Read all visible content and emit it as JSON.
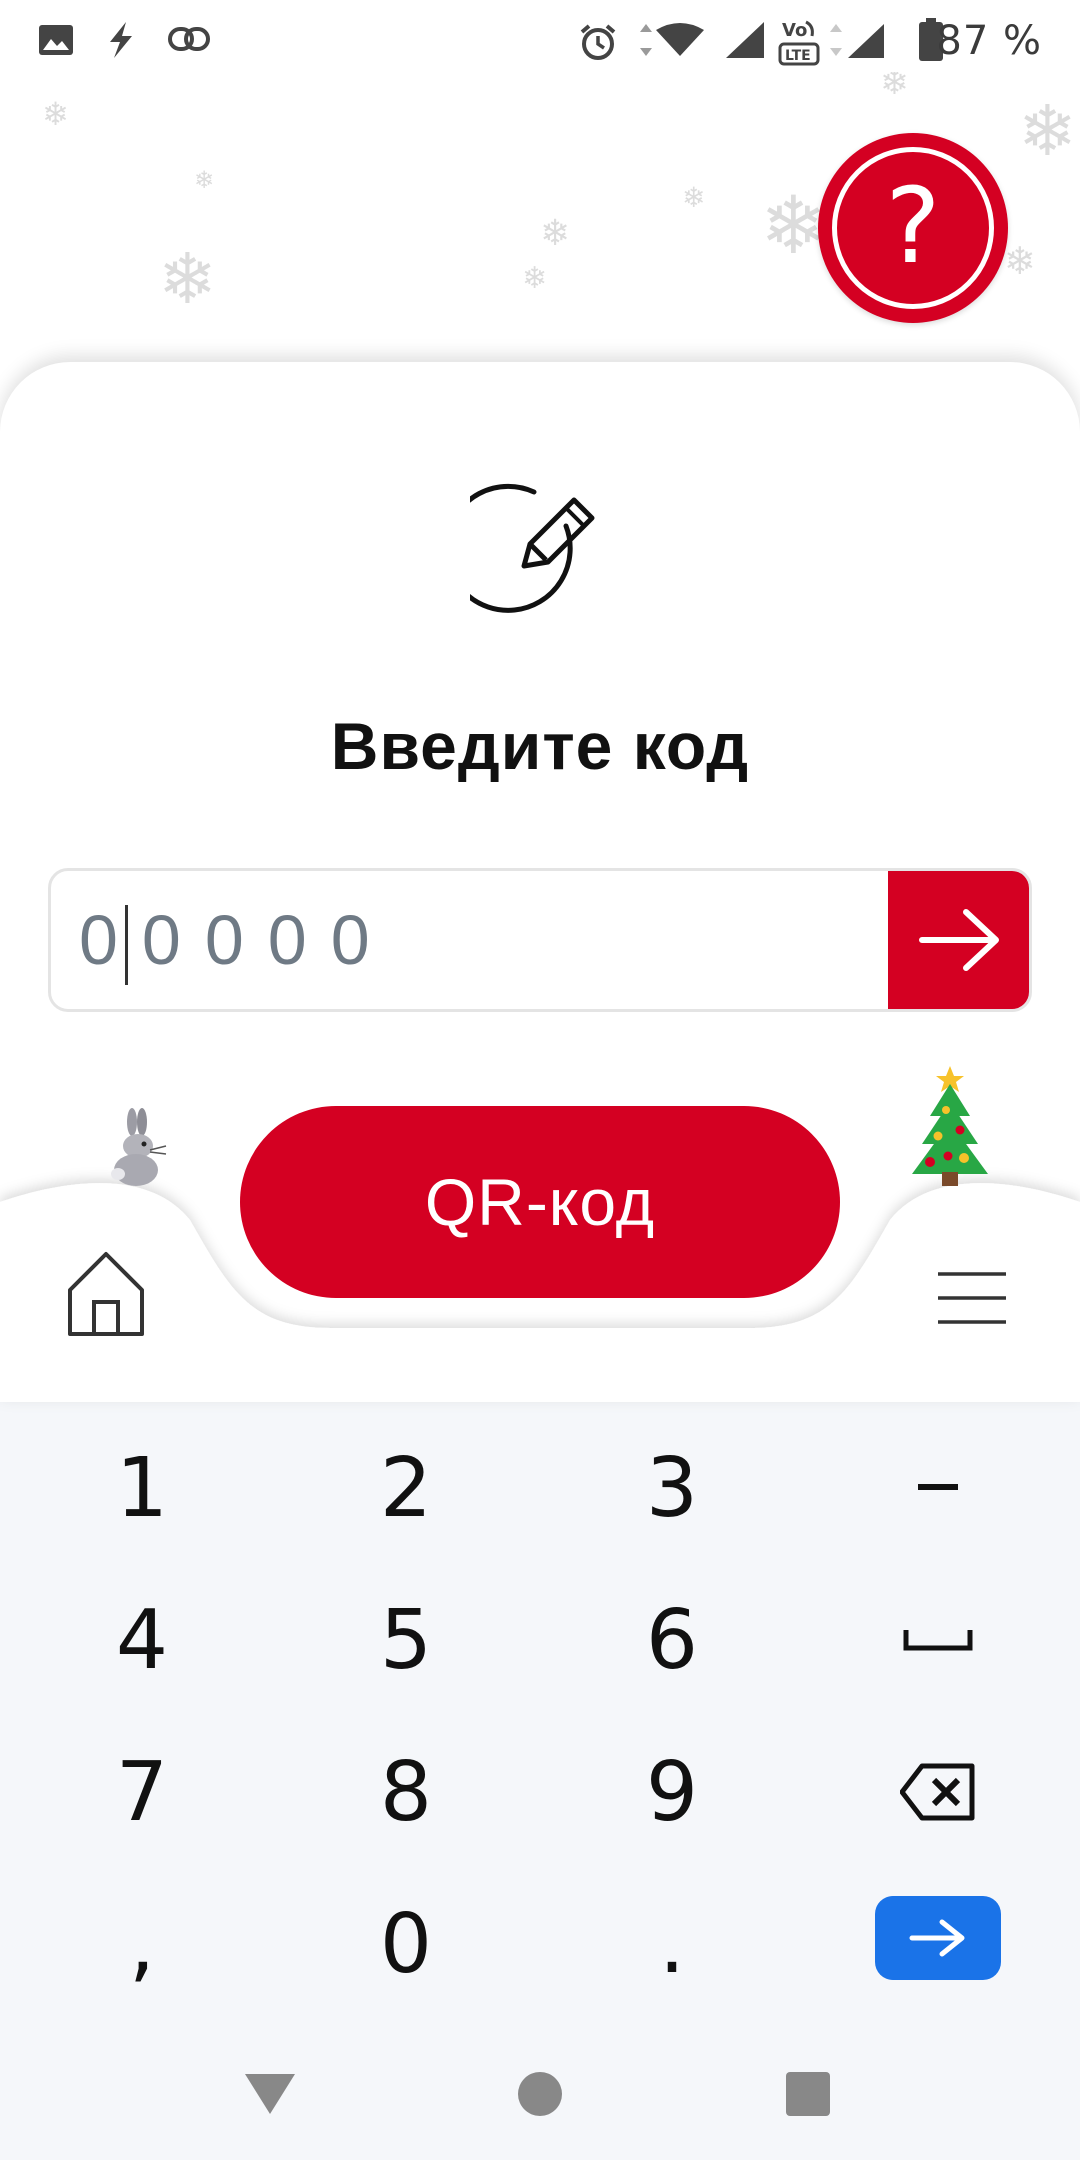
{
  "status_bar": {
    "battery_percent": "87 %",
    "icons": [
      "image-icon",
      "flash-icon",
      "link-icon",
      "alarm-icon",
      "wifi-icon",
      "signal-icon",
      "volte-icon",
      "signal-icon",
      "battery-icon"
    ]
  },
  "help_button": {
    "glyph": "?"
  },
  "main": {
    "title": "Введите код",
    "code_placeholder": "00000",
    "code_value": ""
  },
  "nav": {
    "qr_label": "QR-код"
  },
  "keyboard": {
    "rows": [
      [
        "1",
        "2",
        "3",
        "-"
      ],
      [
        "4",
        "5",
        "6",
        "space"
      ],
      [
        "7",
        "8",
        "9",
        "backspace"
      ],
      [
        ",",
        "0",
        ".",
        "enter"
      ]
    ]
  },
  "colors": {
    "accent": "#d40022",
    "keyboard_enter": "#1a73e8",
    "keyboard_bg": "#f5f7fa"
  }
}
